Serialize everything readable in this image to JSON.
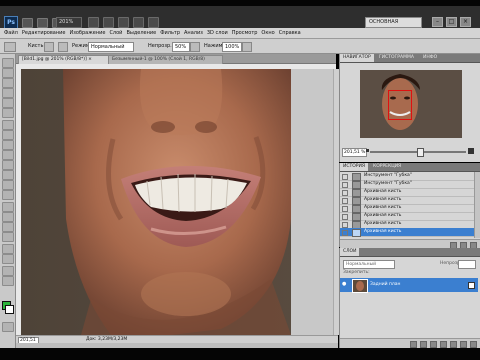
{
  "app": {
    "logo": "Ps",
    "zoom_value": "201%",
    "workspace": "ОСНОВНАЯ"
  },
  "menu": [
    "Файл",
    "Редактирование",
    "Изображение",
    "Слой",
    "Выделение",
    "Фильтр",
    "Анализ",
    "3D слои",
    "Просмотр",
    "Окно",
    "Справка"
  ],
  "options": {
    "brush_label": "Кисть:",
    "mode_label": "Режим:",
    "mode_value": "Нормальный",
    "opacity_label": "Непрозр.:",
    "opacity_value": "50%",
    "flow_label": "Нажим:",
    "flow_value": "100%"
  },
  "document": {
    "active_tab": "[Bild1.jpg @ 201% (RGB/8*)] ×",
    "inactive_tab": "Безымянный-1 @ 100% (Слой 1, RGB/8)",
    "status_zoom": "201,51 %",
    "status_doc": "Док: 3,23M/3,23M"
  },
  "navigator": {
    "tabs": [
      "НАВИГАТОР",
      "ГИСТОГРАММА",
      "ИНФО"
    ],
    "zoom": "201,51 %"
  },
  "history": {
    "tabs": [
      "ИСТОРИЯ",
      "КОРРЕКЦИЯ"
    ],
    "items": [
      {
        "label": "Инструмент \"Губка\"",
        "selected": false
      },
      {
        "label": "Инструмент \"Губка\"",
        "selected": false
      },
      {
        "label": "Архивная кисть",
        "selected": false
      },
      {
        "label": "Архивная кисть",
        "selected": false
      },
      {
        "label": "Архивная кисть",
        "selected": false
      },
      {
        "label": "Архивная кисть",
        "selected": false
      },
      {
        "label": "Архивная кисть",
        "selected": false
      },
      {
        "label": "Архивная кисть",
        "selected": true
      }
    ]
  },
  "layers": {
    "tabs": [
      "СЛОИ"
    ],
    "blend_mode": "Нормальный",
    "opacity_label": "Непрозр.:",
    "lock_label": "Закрепить:",
    "layer_name": "Задний план"
  },
  "colors": {
    "foreground": "#2db53c",
    "background": "#ffffff",
    "selection": "#3b7fd0"
  }
}
